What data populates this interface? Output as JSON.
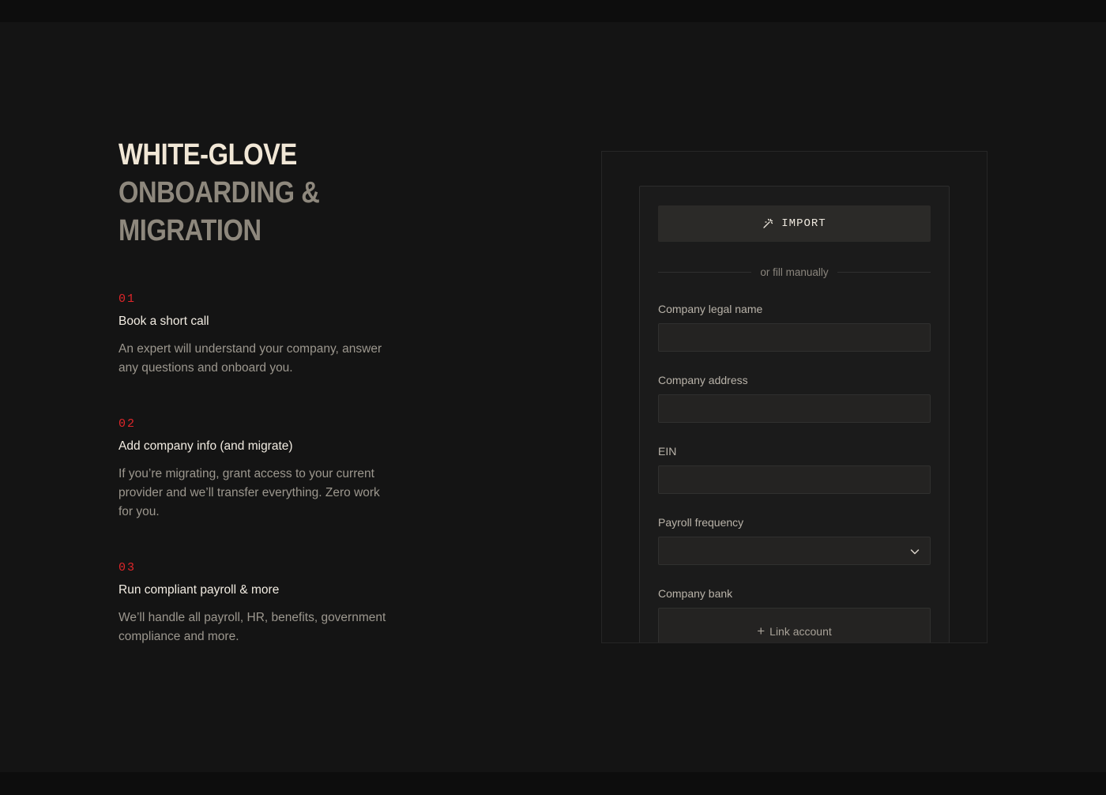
{
  "hero": {
    "line1": "WHITE-GLOVE",
    "line2": "ONBOARDING &",
    "line3": "MIGRATION"
  },
  "steps": [
    {
      "num": "01",
      "title": "Book a short call",
      "desc": "An expert will understand your company, answer any questions and onboard you."
    },
    {
      "num": "02",
      "title": "Add company info (and migrate)",
      "desc": "If you’re migrating, grant access to your current provider and we’ll transfer everything. Zero work for you."
    },
    {
      "num": "03",
      "title": "Run compliant payroll & more",
      "desc": "We’ll handle all payroll, HR, benefits, government compliance and more."
    }
  ],
  "form": {
    "import_label": "IMPORT",
    "import_icon": "magic-wand-icon",
    "divider_text": "or fill manually",
    "fields": [
      {
        "label": "Company legal name",
        "value": ""
      },
      {
        "label": "Company address",
        "value": ""
      },
      {
        "label": "EIN",
        "value": ""
      },
      {
        "label": "Payroll frequency",
        "value": ""
      },
      {
        "label": "Company bank"
      }
    ],
    "link_account_label": "Link account"
  },
  "colors": {
    "accent_red": "#e0262a",
    "headline_light": "#f1e7d6",
    "headline_muted": "#8e887d",
    "background": "#141414"
  }
}
